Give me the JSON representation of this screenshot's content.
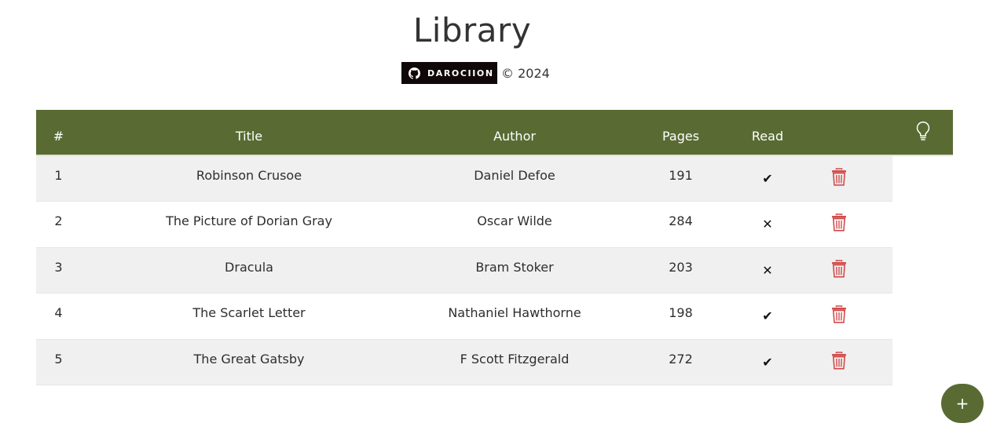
{
  "header": {
    "title": "Library",
    "github_label": "DAROCIION",
    "copyright": "© 2024"
  },
  "table": {
    "columns": [
      "#",
      "Title",
      "Author",
      "Pages",
      "Read"
    ],
    "rows": [
      {
        "num": "1",
        "title": "Robinson Crusoe",
        "author": "Daniel Defoe",
        "pages": "191",
        "read": true
      },
      {
        "num": "2",
        "title": "The Picture of Dorian Gray",
        "author": "Oscar Wilde",
        "pages": "284",
        "read": false
      },
      {
        "num": "3",
        "title": "Dracula",
        "author": "Bram Stoker",
        "pages": "203",
        "read": false
      },
      {
        "num": "4",
        "title": "The Scarlet Letter",
        "author": "Nathaniel Hawthorne",
        "pages": "198",
        "read": true
      },
      {
        "num": "5",
        "title": "The Great Gatsby",
        "author": "F Scott Fitzgerald",
        "pages": "272",
        "read": true
      }
    ],
    "read_yes_glyph": "✔",
    "read_no_glyph": "✕"
  },
  "icons": {
    "github": "github-icon",
    "theme_toggle": "lightbulb-icon",
    "delete": "trash-icon"
  },
  "fab": {
    "label": "+"
  },
  "colors": {
    "accent": "#596b32",
    "delete": "#d24b4b",
    "row_stripe": "#f0f0f0",
    "badge": "#0f0708"
  }
}
